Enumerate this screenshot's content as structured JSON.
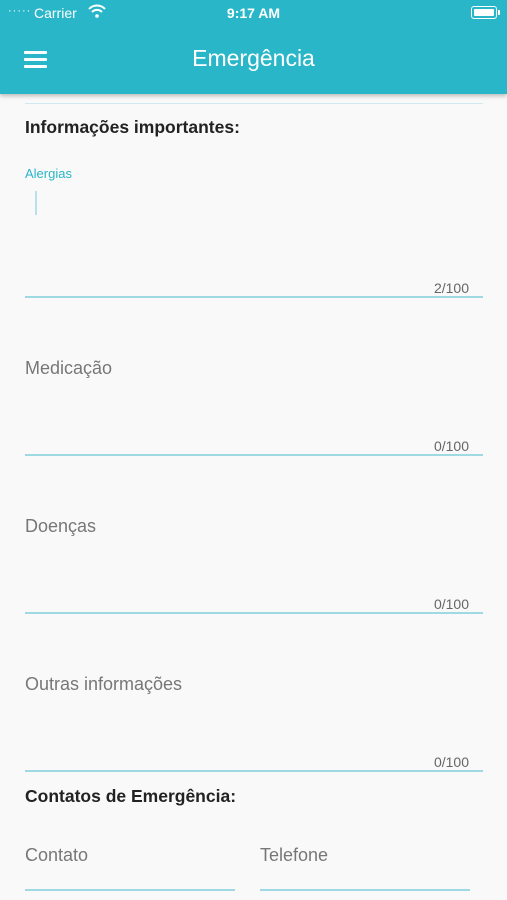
{
  "status_bar": {
    "signal": "·····",
    "carrier": "Carrier",
    "time": "9:17 AM",
    "battery_level": 1.0
  },
  "header": {
    "title": "Emergência"
  },
  "important_info": {
    "heading": "Informações importantes:",
    "fields": [
      {
        "label": "Alergias",
        "counter": "2/100",
        "focused": true
      },
      {
        "label": "Medicação",
        "counter": "0/100",
        "focused": false
      },
      {
        "label": "Doenças",
        "counter": "0/100",
        "focused": false
      },
      {
        "label": "Outras informações",
        "counter": "0/100",
        "focused": false
      }
    ]
  },
  "emergency_contacts": {
    "heading": "Contatos de Emergência:",
    "contact_label": "Contato",
    "phone_label": "Telefone"
  },
  "colors": {
    "primary": "#29b6c8",
    "background": "#f9f9f9",
    "underline": "#9fd9e4"
  }
}
